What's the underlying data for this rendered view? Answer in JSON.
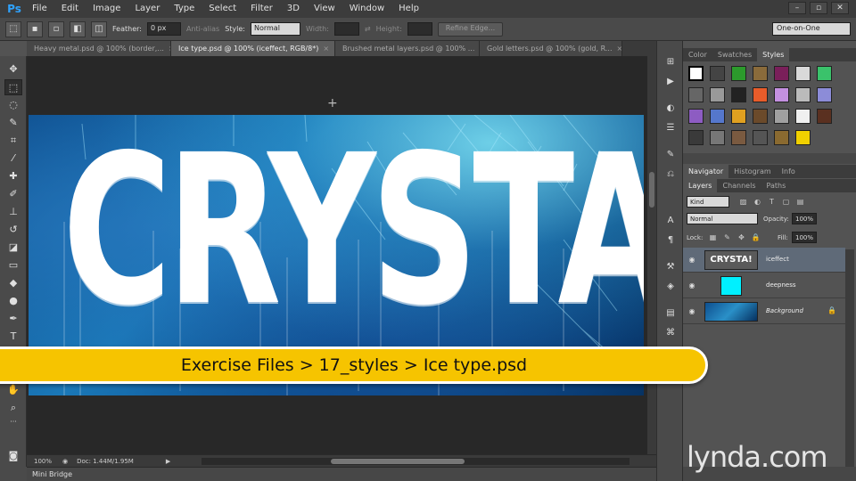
{
  "app": {
    "logo": "Ps",
    "menu": [
      "File",
      "Edit",
      "Image",
      "Layer",
      "Type",
      "Select",
      "Filter",
      "3D",
      "View",
      "Window",
      "Help"
    ],
    "window_controls": [
      "–",
      "▫",
      "✕"
    ]
  },
  "options": {
    "feather_label": "Feather:",
    "feather_value": "0 px",
    "antialias_label": "Anti-alias",
    "style_label": "Style:",
    "style_value": "Normal",
    "width_label": "Width:",
    "height_label": "Height:",
    "refine_label": "Refine Edge...",
    "workspace": "One-on-One"
  },
  "tabs": [
    {
      "label": "Heavy metal.psd @ 100% (border,...",
      "active": false
    },
    {
      "label": "Ice type.psd @ 100% (iceffect, RGB/8*)",
      "active": true
    },
    {
      "label": "Brushed metal layers.psd @ 100% ...",
      "active": false
    },
    {
      "label": "Gold letters.psd @ 100% (gold, R...",
      "active": false
    }
  ],
  "document": {
    "text": "CRYSTA"
  },
  "status": {
    "zoom": "100%",
    "doc_size": "Doc: 1.44M/1.95M"
  },
  "minibridge": "Mini Bridge",
  "panels": {
    "top_tabs": [
      "Color",
      "Swatches",
      "Styles"
    ],
    "mid_tabs": [
      "Navigator",
      "Histogram",
      "Info"
    ],
    "layer_tabs": [
      "Layers",
      "Channels",
      "Paths"
    ],
    "kind": "Kind",
    "blend_mode": "Normal",
    "opacity_label": "Opacity:",
    "opacity_value": "100%",
    "lock_label": "Lock:",
    "fill_label": "Fill:",
    "fill_value": "100%"
  },
  "layers": [
    {
      "name": "iceffect",
      "selected": true,
      "thumb_text": "CRYSTA!"
    },
    {
      "name": "deepness",
      "selected": false
    },
    {
      "name": "Background",
      "selected": false
    }
  ],
  "banner": "Exercise Files > 17_styles > Ice type.psd",
  "watermark": "lynda.com",
  "colors": {
    "banner": "#f6c400",
    "ps_blue": "#2fa3ff",
    "deepness_fill": "#00f0ff",
    "layer_selected": "#5f6a78"
  }
}
